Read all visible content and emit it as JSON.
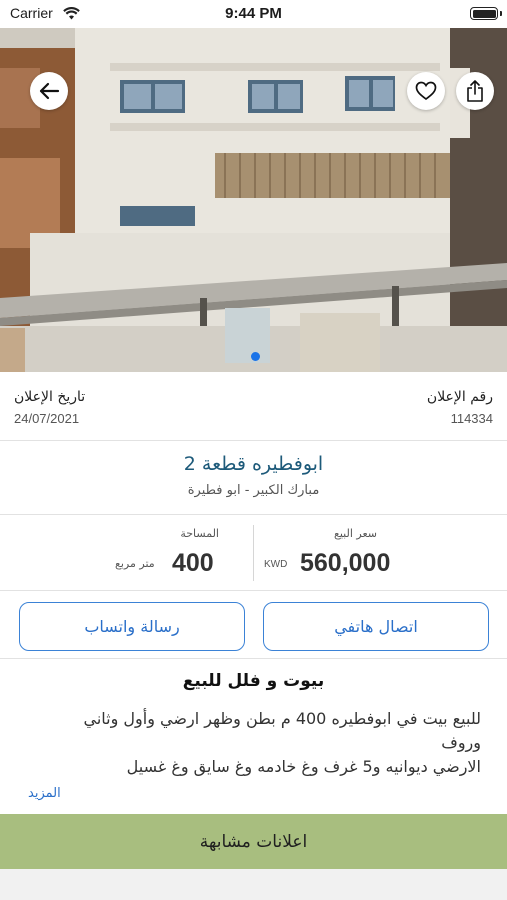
{
  "status_bar": {
    "carrier": "Carrier",
    "time": "9:44 PM"
  },
  "photo": {
    "current_page": 1
  },
  "ad_meta": {
    "ad_number_label": "رقم الإعلان",
    "ad_number": "114334",
    "ad_date_label": "تاريخ الإعلان",
    "ad_date": "24/07/2021"
  },
  "listing": {
    "title": "ابوفطيره قطعة 2",
    "location": "مبارك الكبير - ابو فطيرة"
  },
  "stats": {
    "price_label": "سعر البيع",
    "price_value": "560,000",
    "price_unit": "KWD",
    "area_label": "المساحة",
    "area_value": "400",
    "area_unit": "متر مربع"
  },
  "actions": {
    "call_label": "اتصال هاتفي",
    "whatsapp_label": "رسالة واتساب"
  },
  "description": {
    "category": "بيوت و فلل للبيع",
    "lines": [
      "للبيع بيت في ابوفطيره 400 م بطن وظهر ارضي وأول وثاني",
      "وروف",
      "الارضي ديوانيه و5 غرف وغ خادمه وغ سايق وغ غسيل"
    ],
    "more_label": "المزيد"
  },
  "similar": {
    "label": "اعلانات مشابهة"
  },
  "colors": {
    "accent_blue": "#2a6fc9",
    "title_blue": "#1d5a7a",
    "similar_bar_green": "#a8be7f"
  }
}
